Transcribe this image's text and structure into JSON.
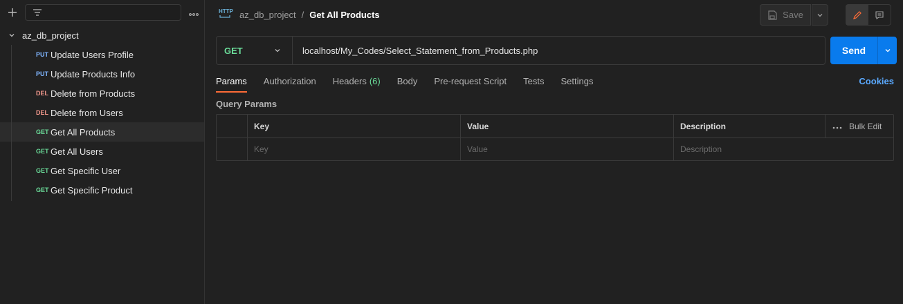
{
  "sidebar": {
    "collection_name": "az_db_project",
    "requests": [
      {
        "method": "PUT",
        "label": "Update Users Profile"
      },
      {
        "method": "PUT",
        "label": "Update Products Info"
      },
      {
        "method": "DEL",
        "label": "Delete from Products"
      },
      {
        "method": "DEL",
        "label": "Delete from Users"
      },
      {
        "method": "GET",
        "label": "Get All Products"
      },
      {
        "method": "GET",
        "label": "Get All Users"
      },
      {
        "method": "GET",
        "label": "Get Specific User"
      },
      {
        "method": "GET",
        "label": "Get Specific Product"
      }
    ]
  },
  "header": {
    "breadcrumb_parent": "az_db_project",
    "breadcrumb_sep": "/",
    "breadcrumb_current": "Get All Products",
    "http_icon_text": "HTTP",
    "save_label": "Save"
  },
  "request": {
    "method": "GET",
    "url": "localhost/My_Codes/Select_Statement_from_Products.php",
    "send_label": "Send"
  },
  "tabs": [
    {
      "label": "Params",
      "count": ""
    },
    {
      "label": "Authorization",
      "count": ""
    },
    {
      "label": "Headers",
      "count": "(6)"
    },
    {
      "label": "Body",
      "count": ""
    },
    {
      "label": "Pre-request Script",
      "count": ""
    },
    {
      "label": "Tests",
      "count": ""
    },
    {
      "label": "Settings",
      "count": ""
    }
  ],
  "cookies_label": "Cookies",
  "query_params": {
    "title": "Query Params",
    "headers": {
      "key": "Key",
      "value": "Value",
      "description": "Description",
      "bulk_edit": "Bulk Edit"
    },
    "placeholders": {
      "key": "Key",
      "value": "Value",
      "description": "Description"
    }
  },
  "colors": {
    "accent": "#ff6c37",
    "send": "#097bed",
    "get": "#6bdd9a",
    "put": "#7fb5ff",
    "del": "#f79a8e"
  }
}
